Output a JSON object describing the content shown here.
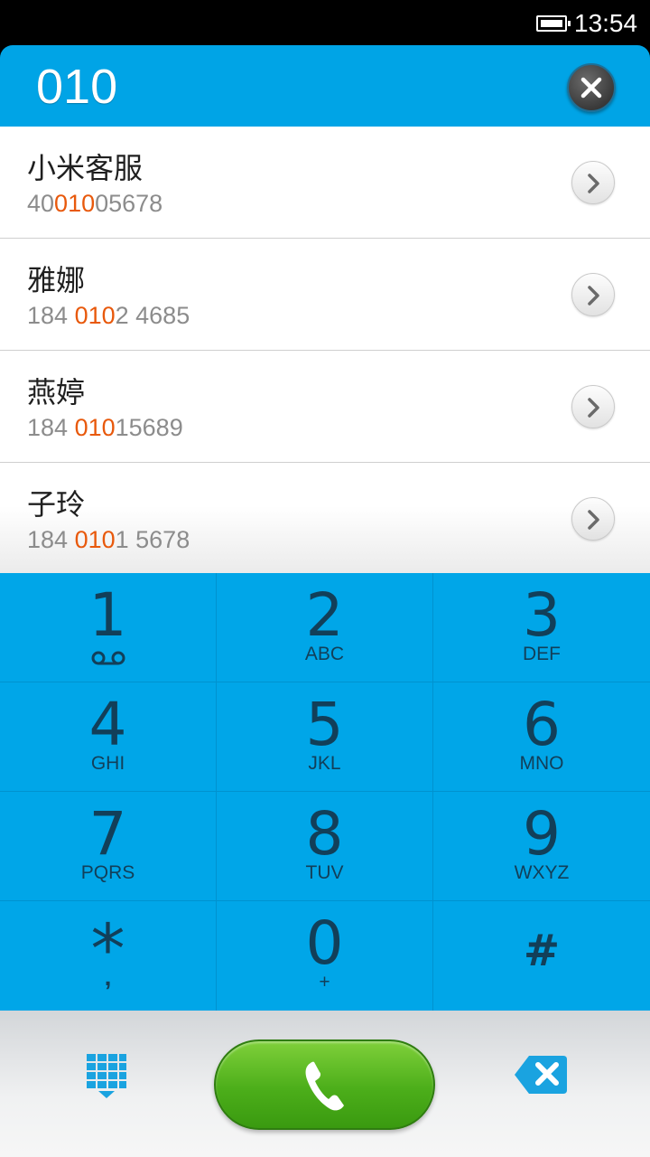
{
  "status": {
    "time": "13:54"
  },
  "header": {
    "dialed": "010"
  },
  "contacts": [
    {
      "name": "小米客服",
      "num_pre": "40",
      "num_hl": "010",
      "num_post": "05678"
    },
    {
      "name": "雅娜",
      "num_pre": "184 ",
      "num_hl": "010",
      "num_post": "2 4685"
    },
    {
      "name": "燕婷",
      "num_pre": "184 ",
      "num_hl": "010",
      "num_post": "15689"
    },
    {
      "name": "子玲",
      "num_pre": "184 ",
      "num_hl": "010",
      "num_post": "1 5678"
    }
  ],
  "keys": [
    {
      "digit": "1",
      "letters": ""
    },
    {
      "digit": "2",
      "letters": "ABC"
    },
    {
      "digit": "3",
      "letters": "DEF"
    },
    {
      "digit": "4",
      "letters": "GHI"
    },
    {
      "digit": "5",
      "letters": "JKL"
    },
    {
      "digit": "6",
      "letters": "MNO"
    },
    {
      "digit": "7",
      "letters": "PQRS"
    },
    {
      "digit": "8",
      "letters": "TUV"
    },
    {
      "digit": "9",
      "letters": "WXYZ"
    },
    {
      "digit": "*",
      "letters": ","
    },
    {
      "digit": "0",
      "letters": "+"
    },
    {
      "digit": "#",
      "letters": ""
    }
  ],
  "colors": {
    "header": "#00a4e6",
    "keypad": "#00a6e8",
    "highlight": "#e8590c",
    "call": "#4cae1a"
  }
}
